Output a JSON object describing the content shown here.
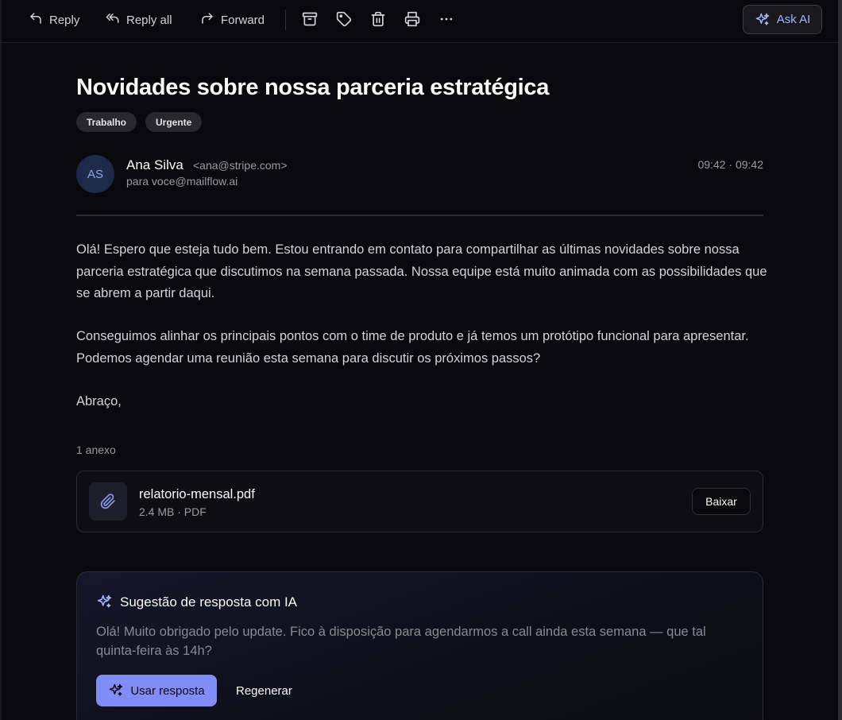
{
  "toolbar": {
    "reply_label": "Reply",
    "reply_all_label": "Reply all",
    "forward_label": "Forward",
    "icons": [
      "archive-icon",
      "tag-icon",
      "trash-icon",
      "printer-icon",
      "more-icon"
    ],
    "ask_ai_label": "Ask AI"
  },
  "email": {
    "subject": "Novidades sobre nossa parceria estratégica",
    "tags": [
      "Trabalho",
      "Urgente"
    ],
    "sender": {
      "initials": "AS",
      "name": "Ana Silva",
      "email": "<ana@stripe.com>",
      "recipient_line": "para voce@mailflow.ai",
      "time": "09:42 · 09:42"
    },
    "body": {
      "p1": "Olá! Espero que esteja tudo bem. Estou entrando em contato para compartilhar as últimas novidades sobre nossa parceria estratégica que discutimos na semana passada. Nossa equipe está muito animada com as possibilidades que se abrem a partir daqui.",
      "p2": "Conseguimos alinhar os principais pontos com o time de produto e já temos um protótipo funcional para apresentar. Podemos agendar uma reunião esta semana para discutir os próximos passos?",
      "p3": "Abraço,"
    },
    "attachments": {
      "count_label": "1 anexo",
      "items": [
        {
          "name": "relatorio-mensal.pdf",
          "meta": "2.4 MB · PDF",
          "download_label": "Baixar"
        }
      ]
    }
  },
  "ai_suggestion": {
    "title": "Sugestão de resposta com IA",
    "text": "Olá! Muito obrigado pelo update. Fico à disposição para agendarmos a call ainda esta semana — que tal quinta-feira às 14h?",
    "use_label": "Usar resposta",
    "regenerate_label": "Regenerar"
  },
  "colors": {
    "background": "#09090b",
    "accent": "#818cf8",
    "avatar_bg": "#1e2a4a"
  }
}
